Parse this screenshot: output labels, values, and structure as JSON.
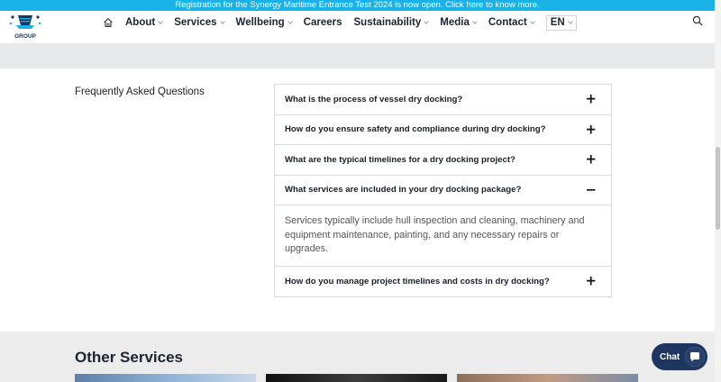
{
  "announcement": "Registration for the Synergy Maritime Entrance Test 2024 is now open. Click here to know more.",
  "header": {
    "logo_text": "GROUP",
    "nav": [
      {
        "label": "About",
        "has_dropdown": true
      },
      {
        "label": "Services",
        "has_dropdown": true
      },
      {
        "label": "Wellbeing",
        "has_dropdown": true
      },
      {
        "label": "Careers",
        "has_dropdown": false
      },
      {
        "label": "Sustainability",
        "has_dropdown": true
      },
      {
        "label": "Media",
        "has_dropdown": true
      },
      {
        "label": "Contact",
        "has_dropdown": true
      }
    ],
    "language": "EN",
    "icons": {
      "home": "home-icon",
      "search": "search-icon",
      "dropdown": "chevron-down-icon"
    }
  },
  "faq": {
    "title": "Frequently Asked Questions",
    "items": [
      {
        "question": "What is the process of vessel dry docking?",
        "toggle": "+"
      },
      {
        "question": "How do you ensure safety and compliance during dry docking?",
        "toggle": "+"
      },
      {
        "question": "What are the typical timelines for a dry docking project?",
        "toggle": "+"
      },
      {
        "question": "What services are included in your dry docking package?",
        "toggle": "−",
        "answer": "Services typically include hull inspection and cleaning, machinery and equipment maintenance, painting, and any necessary repairs or upgrades."
      },
      {
        "question": "How do you manage project timelines and costs in dry docking?",
        "toggle": "+"
      }
    ]
  },
  "other_services": {
    "title": "Other Services"
  },
  "chat": {
    "label": "Chat",
    "icon": "chat-bubble-icon"
  },
  "colors": {
    "announcement_bg": "#1ab0e8",
    "chat_bg": "#1e3561",
    "nav_text": "#1c2430"
  }
}
